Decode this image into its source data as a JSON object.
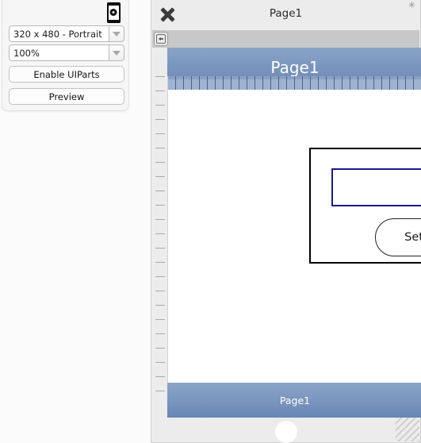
{
  "tool_panel": {
    "device_icon": "phone-camera-icon",
    "device_select": {
      "value": "320 x 480 - Portrait",
      "arrow": "chevron-down-icon"
    },
    "zoom_select": {
      "value": "100%",
      "arrow": "chevron-down-icon"
    },
    "enable_uiparts_label": "Enable UIParts",
    "preview_label": "Preview"
  },
  "editor": {
    "close_icon": "close-x-icon",
    "title": "Page1",
    "modified_marker": "✳",
    "toolbar": {
      "return_icon": "return-arrow-icon"
    },
    "device_preview": {
      "header_title": "Page1",
      "footer_title": "Page1",
      "home_button": "home-circle-button",
      "panel": {
        "textbox": {
          "value": "",
          "placeholder": ""
        },
        "button_label": "Set Text"
      }
    },
    "resize_grip": "resize-grip-icon"
  },
  "colors": {
    "header_blue": "#7b96bf",
    "ruler_blue": "#9fb2d0",
    "textbox_border": "#1a1a8c",
    "panel_border": "#000000",
    "window_chrome": "#ececec"
  }
}
